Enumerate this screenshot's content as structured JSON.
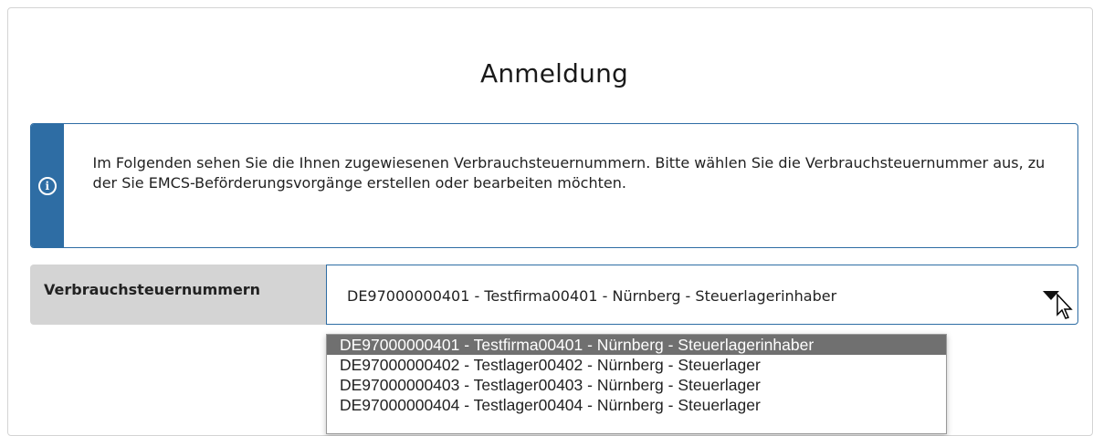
{
  "page": {
    "title": "Anmeldung"
  },
  "info": {
    "icon": "info-icon",
    "icon_glyph": "i",
    "text": "Im Folgenden sehen Sie die Ihnen zugewiesenen Verbrauchsteuernummern. Bitte wählen Sie die Verbrauchsteuernummer aus, zu der Sie EMCS-Beförderungsvorgänge erstellen oder bearbeiten möchten."
  },
  "select": {
    "label": "Verbrauchsteuernummern",
    "value": "DE97000000401 - Testfirma00401 - Nürnberg - Steuerlagerinhaber"
  },
  "dropdown": {
    "options": [
      "DE97000000401 - Testfirma00401 - Nürnberg - Steuerlagerinhaber",
      "DE97000000402 - Testlager00402 - Nürnberg - Steuerlager",
      "DE97000000403 - Testlager00403 - Nürnberg - Steuerlager",
      "DE97000000404 - Testlager00404 - Nürnberg - Steuerlager"
    ],
    "selected_index": 0
  },
  "colors": {
    "accent": "#2e6da4",
    "label_bg": "#d4d4d4",
    "selected_option_bg": "#707070"
  }
}
